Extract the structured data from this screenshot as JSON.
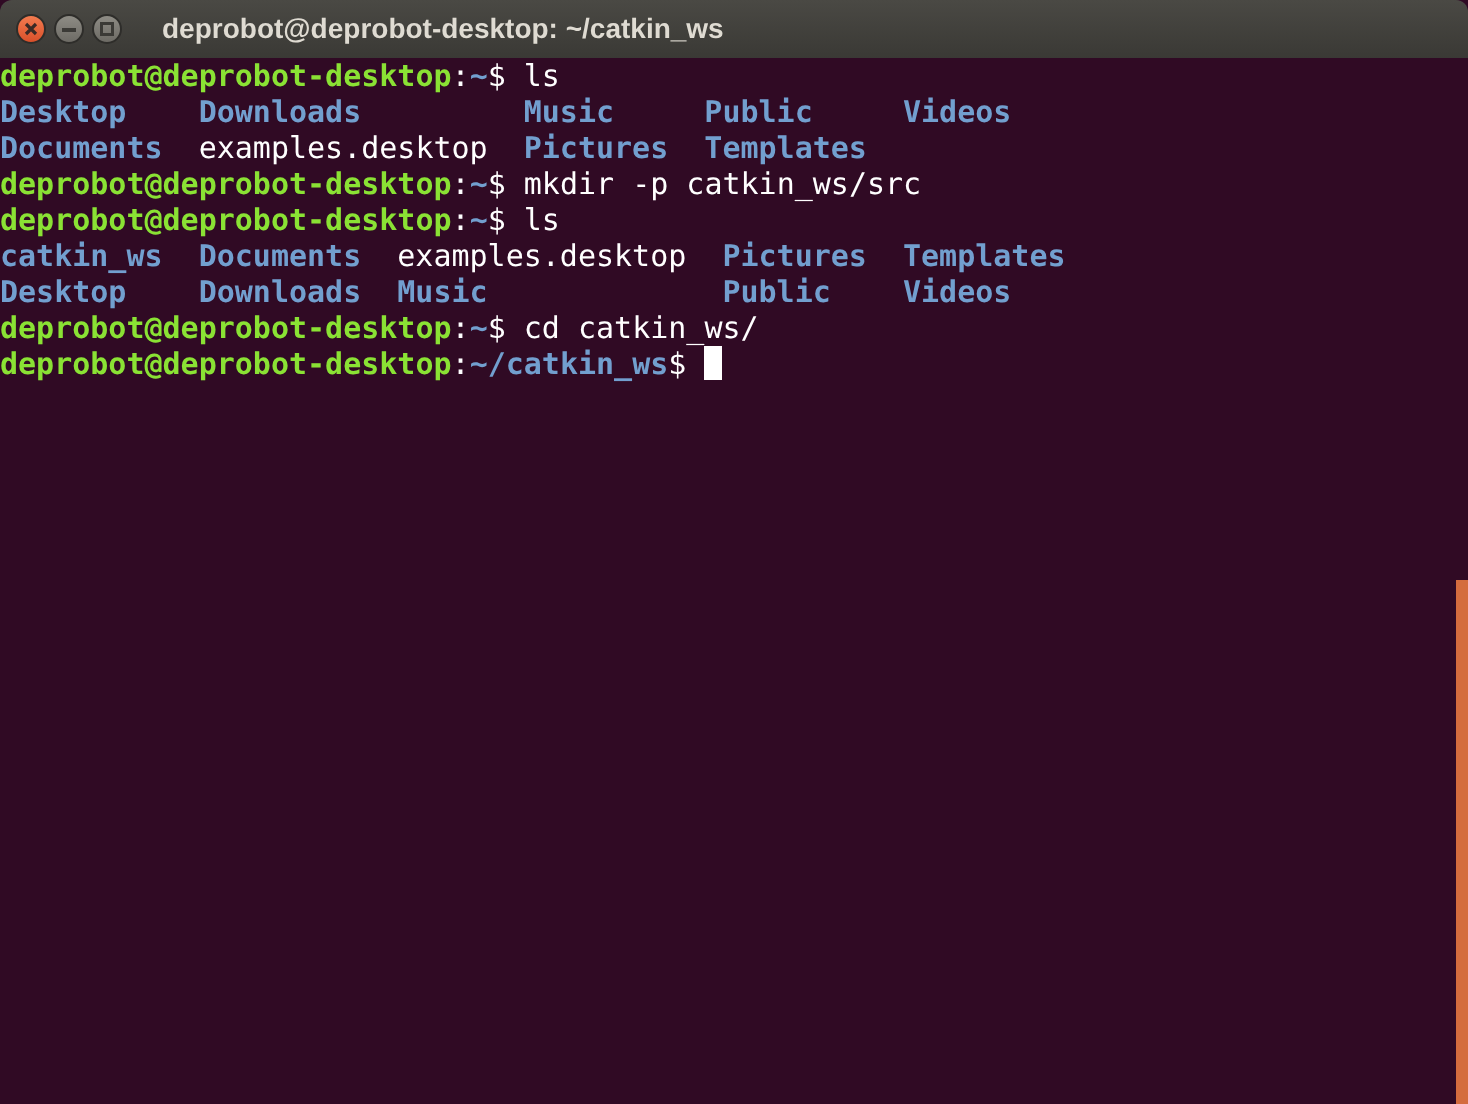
{
  "window": {
    "title": "deprobot@deprobot-desktop: ~/catkin_ws"
  },
  "terminal": {
    "lines": [
      {
        "kind": "prompt",
        "user_host": "deprobot@deprobot-desktop",
        "separator": ":",
        "path": "~",
        "symbol": "$",
        "command": "ls"
      },
      {
        "kind": "listing",
        "rows": [
          [
            {
              "name": "Desktop",
              "is_directory": true
            },
            {
              "name": "Downloads",
              "is_directory": true
            },
            {
              "name": "Music",
              "is_directory": true
            },
            {
              "name": "Public",
              "is_directory": true
            },
            {
              "name": "Videos",
              "is_directory": true
            }
          ],
          [
            {
              "name": "Documents",
              "is_directory": true
            },
            {
              "name": "examples.desktop",
              "is_directory": false
            },
            {
              "name": "Pictures",
              "is_directory": true
            },
            {
              "name": "Templates",
              "is_directory": true
            }
          ]
        ]
      },
      {
        "kind": "prompt",
        "user_host": "deprobot@deprobot-desktop",
        "separator": ":",
        "path": "~",
        "symbol": "$",
        "command": "mkdir -p catkin_ws/src"
      },
      {
        "kind": "prompt",
        "user_host": "deprobot@deprobot-desktop",
        "separator": ":",
        "path": "~",
        "symbol": "$",
        "command": "ls"
      },
      {
        "kind": "listing",
        "rows": [
          [
            {
              "name": "catkin_ws",
              "is_directory": true
            },
            {
              "name": "Documents",
              "is_directory": true
            },
            {
              "name": "examples.desktop",
              "is_directory": false
            },
            {
              "name": "Pictures",
              "is_directory": true
            },
            {
              "name": "Templates",
              "is_directory": true
            }
          ],
          [
            {
              "name": "Desktop",
              "is_directory": true
            },
            {
              "name": "Downloads",
              "is_directory": true
            },
            {
              "name": "Music",
              "is_directory": true
            },
            {
              "name": "Public",
              "is_directory": true
            },
            {
              "name": "Videos",
              "is_directory": true
            }
          ]
        ]
      },
      {
        "kind": "prompt",
        "user_host": "deprobot@deprobot-desktop",
        "separator": ":",
        "path": "~",
        "symbol": "$",
        "command": "cd catkin_ws/"
      },
      {
        "kind": "prompt",
        "user_host": "deprobot@deprobot-desktop",
        "separator": ":",
        "path": "~/catkin_ws",
        "symbol": "$",
        "cursor": true
      }
    ]
  }
}
